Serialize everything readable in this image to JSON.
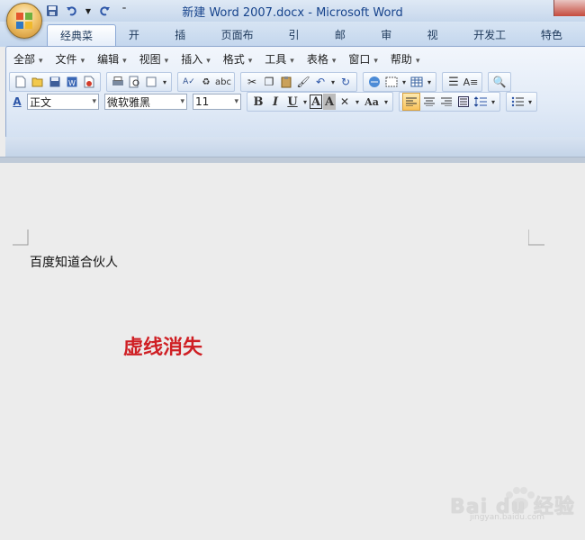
{
  "window": {
    "title": "新建 Word 2007.docx - Microsoft Word"
  },
  "tabs": [
    {
      "label": "经典菜单",
      "active": true
    },
    {
      "label": "开始"
    },
    {
      "label": "插入"
    },
    {
      "label": "页面布局"
    },
    {
      "label": "引用"
    },
    {
      "label": "邮件"
    },
    {
      "label": "审阅"
    },
    {
      "label": "视图"
    },
    {
      "label": "开发工具"
    },
    {
      "label": "特色功"
    }
  ],
  "menus": [
    "全部",
    "文件",
    "编辑",
    "视图",
    "插入",
    "格式",
    "工具",
    "表格",
    "窗口",
    "帮助"
  ],
  "format": {
    "style_value": "正文",
    "font_value": "微软雅黑",
    "size_value": "11",
    "bold": "B",
    "italic": "I",
    "underline": "U",
    "char_border": "A",
    "char_shading": "A",
    "change_case": "Aa"
  },
  "document": {
    "body_text": "百度知道合伙人"
  },
  "annotation": {
    "text": "虚线消失",
    "color": "#cf1f24"
  },
  "watermark": {
    "brand": "Bai du 经验",
    "url": "jingyan.baidu.com"
  },
  "icons": [
    "save-icon",
    "undo-icon",
    "redo-icon",
    "new-icon",
    "open-icon",
    "print-icon",
    "preview-icon",
    "cut-icon",
    "copy-icon",
    "paste-icon",
    "format-painter-icon",
    "hyperlink-icon",
    "table-icon",
    "align-left-icon",
    "align-center-icon",
    "align-right-icon",
    "justify-icon",
    "line-spacing-icon",
    "bullets-icon"
  ]
}
